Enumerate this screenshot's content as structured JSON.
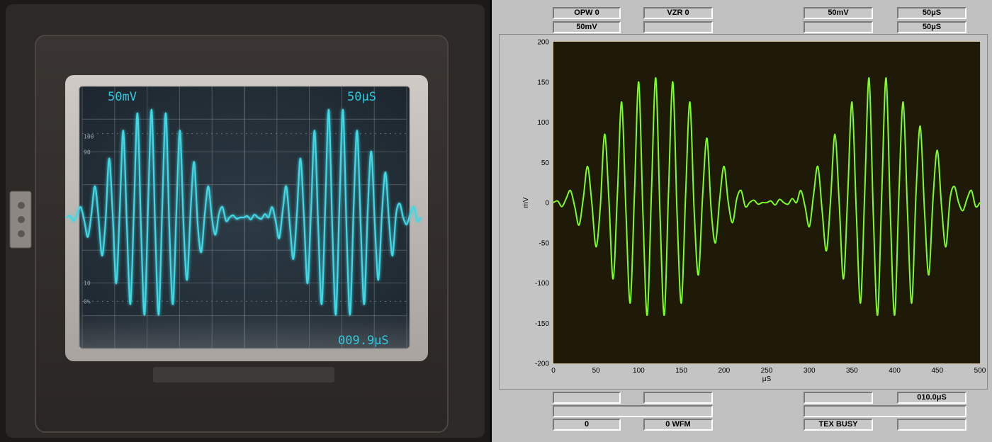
{
  "scope": {
    "volts_label": "50mV",
    "time_label": "50μS",
    "delay_readout": "009.9μS",
    "graticule_marks": [
      "100",
      "90",
      "10",
      "0%"
    ],
    "trace_color": "#3fd8e6",
    "readout_color": "#2fc8dc"
  },
  "panel": {
    "top_left": [
      "OPW 0",
      "50mV"
    ],
    "top_mid": [
      "VZR 0",
      ""
    ],
    "top_right_a": [
      "50mV",
      ""
    ],
    "top_right_b": [
      "50μS",
      "50μS"
    ],
    "bottom_left": [
      "",
      "",
      "0"
    ],
    "bottom_mid": [
      "",
      "0 WFM"
    ],
    "bottom_right_a": [
      "",
      "",
      "TEX BUSY"
    ],
    "bottom_right_b": [
      "010.0μS",
      ""
    ]
  },
  "chart_data": {
    "type": "line",
    "title": "",
    "xlabel": "μS",
    "ylabel": "mV",
    "xlim": [
      0,
      500
    ],
    "ylim": [
      -200,
      200
    ],
    "xticks": [
      0,
      50,
      100,
      150,
      200,
      250,
      300,
      350,
      400,
      450,
      500
    ],
    "yticks": [
      -200,
      -150,
      -100,
      -50,
      0,
      50,
      100,
      150,
      200
    ],
    "grid": true,
    "line_color": "#7cff1a",
    "grid_major_color": "#c9a84a",
    "grid_minor_color": "#7a6a30",
    "background_color": "#1f1a08",
    "series": [
      {
        "x": [
          0,
          5,
          10,
          15,
          20,
          25,
          30,
          35,
          40,
          45,
          50,
          55,
          60,
          65,
          70,
          75,
          80,
          85,
          90,
          95,
          100,
          105,
          110,
          115,
          120,
          125,
          130,
          135,
          140,
          145,
          150,
          155,
          160,
          165,
          170,
          175,
          180,
          185,
          190,
          195,
          200,
          205,
          210,
          215,
          220,
          225,
          230,
          235,
          240,
          245,
          250,
          255,
          260,
          265,
          270,
          275,
          280,
          285,
          290,
          295,
          300,
          305,
          310,
          315,
          320,
          325,
          330,
          335,
          340,
          345,
          350,
          355,
          360,
          365,
          370,
          375,
          380,
          385,
          390,
          395,
          400,
          405,
          410,
          415,
          420,
          425,
          430,
          435,
          440,
          445,
          450,
          455,
          460,
          465,
          470,
          475,
          480,
          485,
          490,
          495,
          500
        ],
        "y": [
          0,
          2,
          -5,
          5,
          15,
          -5,
          -28,
          5,
          45,
          0,
          -55,
          -5,
          85,
          5,
          -95,
          10,
          125,
          -10,
          -125,
          10,
          150,
          -15,
          -140,
          15,
          155,
          -15,
          -140,
          15,
          150,
          -15,
          -125,
          10,
          125,
          -10,
          -90,
          10,
          80,
          -10,
          -50,
          5,
          45,
          0,
          -25,
          5,
          15,
          -5,
          0,
          3,
          -2,
          0,
          0,
          2,
          -3,
          4,
          0,
          -2,
          5,
          0,
          15,
          -5,
          -30,
          10,
          45,
          -10,
          -60,
          5,
          85,
          0,
          -95,
          10,
          125,
          -10,
          -125,
          15,
          155,
          -15,
          -140,
          15,
          155,
          -15,
          -140,
          10,
          125,
          -10,
          -125,
          10,
          95,
          -10,
          -90,
          5,
          65,
          -5,
          -55,
          5,
          20,
          0,
          -10,
          5,
          15,
          -5,
          0
        ]
      }
    ]
  }
}
